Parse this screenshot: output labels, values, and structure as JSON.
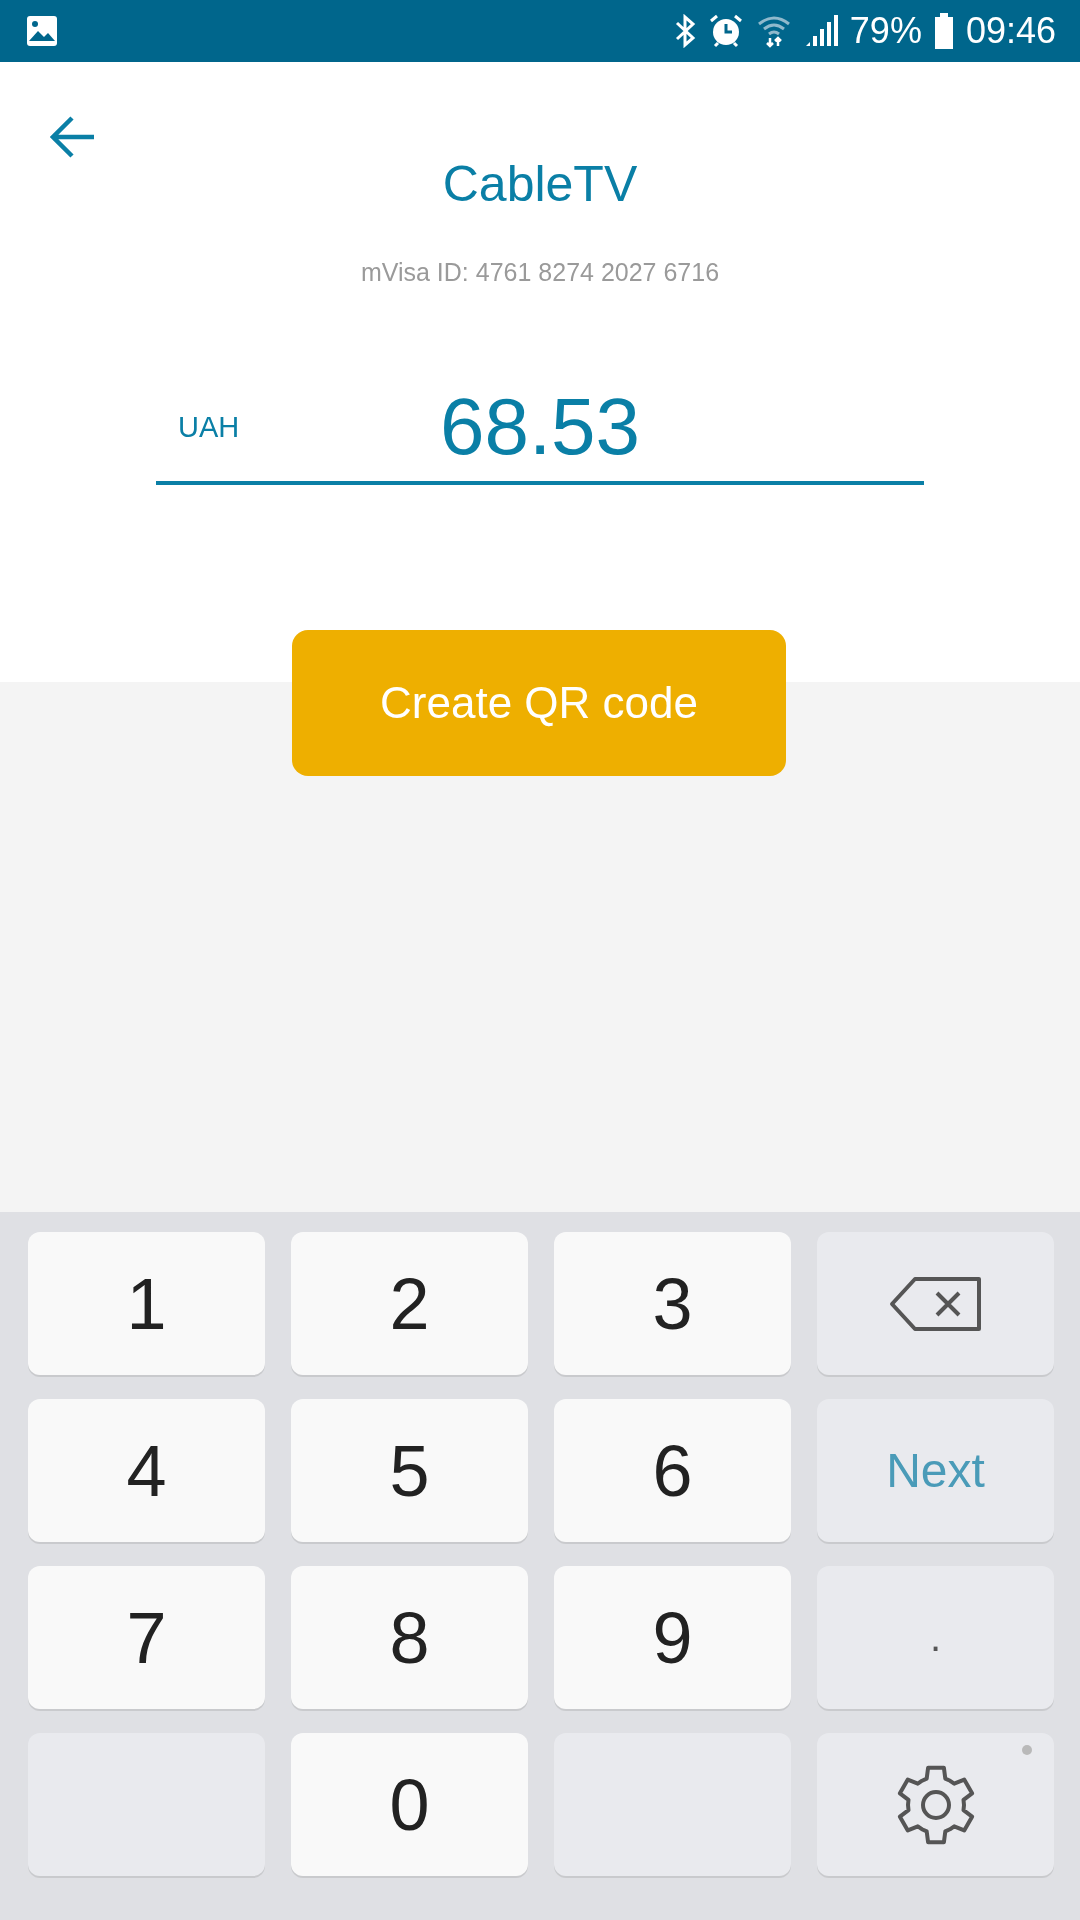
{
  "status_bar": {
    "battery": "79%",
    "time": "09:46"
  },
  "header": {
    "title": "CableTV",
    "subtitle": "mVisa ID: 4761 8274 2027 6716"
  },
  "amount": {
    "currency": "UAH",
    "value": "68.53"
  },
  "primary_button": {
    "label": "Create QR code"
  },
  "keyboard": {
    "keys": [
      {
        "kind": "digit",
        "label": "1"
      },
      {
        "kind": "digit",
        "label": "2"
      },
      {
        "kind": "digit",
        "label": "3"
      },
      {
        "kind": "backspace"
      },
      {
        "kind": "digit",
        "label": "4"
      },
      {
        "kind": "digit",
        "label": "5"
      },
      {
        "kind": "digit",
        "label": "6"
      },
      {
        "kind": "action",
        "label": "Next"
      },
      {
        "kind": "digit",
        "label": "7"
      },
      {
        "kind": "digit",
        "label": "8"
      },
      {
        "kind": "digit",
        "label": "9"
      },
      {
        "kind": "symbol",
        "label": "."
      },
      {
        "kind": "blank"
      },
      {
        "kind": "digit",
        "label": "0"
      },
      {
        "kind": "blank"
      },
      {
        "kind": "settings"
      }
    ]
  }
}
